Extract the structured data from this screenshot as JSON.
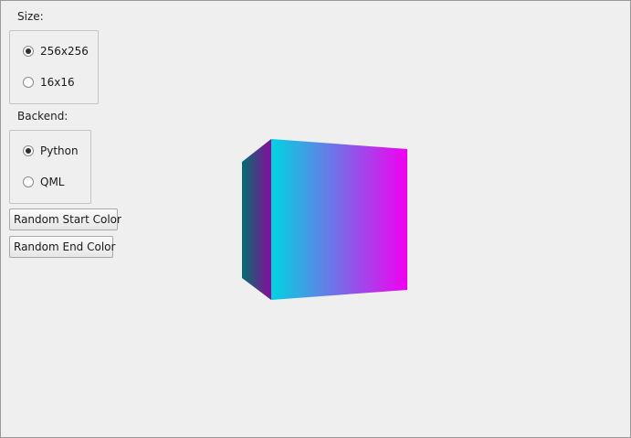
{
  "size": {
    "label": "Size:",
    "options": [
      {
        "label": "256x256",
        "checked": true
      },
      {
        "label": "16x16",
        "checked": false
      }
    ]
  },
  "backend": {
    "label": "Backend:",
    "options": [
      {
        "label": "Python",
        "checked": true
      },
      {
        "label": "QML",
        "checked": false
      }
    ]
  },
  "buttons": {
    "random_start": "Random Start Color",
    "random_end": "Random End Color"
  },
  "cube": {
    "start_color": "#00d5e0",
    "end_color": "#f200f0",
    "side_start_color": "#00706f",
    "side_end_color": "#8a0a9c"
  }
}
